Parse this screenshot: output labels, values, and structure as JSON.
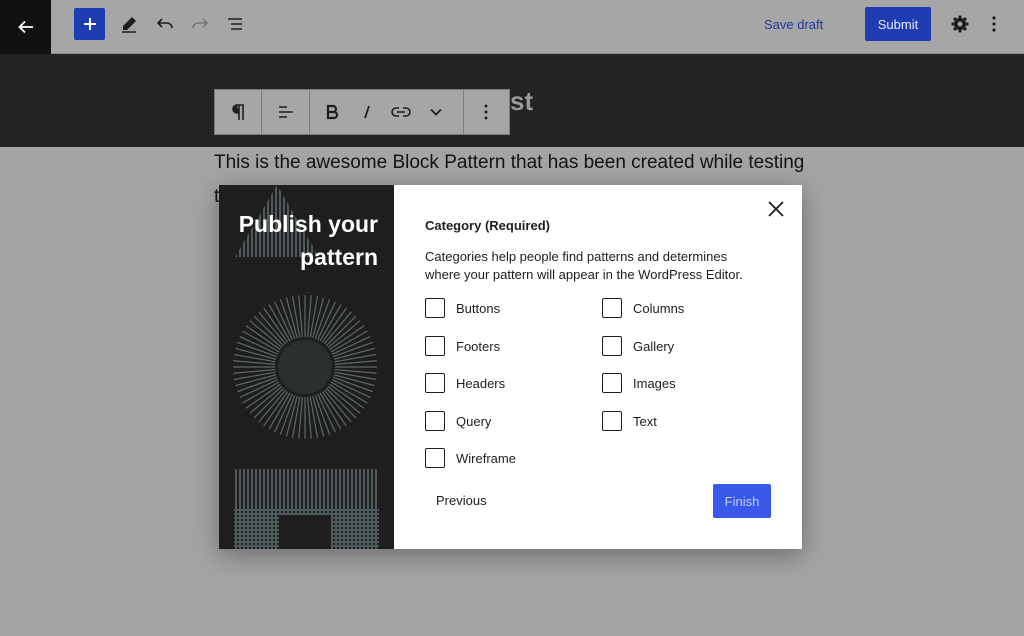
{
  "toolbar": {
    "save_draft": "Save draft",
    "submit": "Submit"
  },
  "editor": {
    "title_fragment": "st",
    "paragraph_line1": "This is the awesome Block Pattern that has been created while testing",
    "paragraph_line2": "t"
  },
  "modal": {
    "side_title": "Publish your pattern",
    "category_heading": "Category (Required)",
    "category_help": "Categories help people find patterns and determines where your pattern will appear in the WordPress Editor.",
    "categories": [
      {
        "label": "Buttons",
        "checked": false
      },
      {
        "label": "Columns",
        "checked": false
      },
      {
        "label": "Footers",
        "checked": false
      },
      {
        "label": "Gallery",
        "checked": false
      },
      {
        "label": "Headers",
        "checked": false
      },
      {
        "label": "Images",
        "checked": false
      },
      {
        "label": "Query",
        "checked": false
      },
      {
        "label": "Text",
        "checked": false
      },
      {
        "label": "Wireframe",
        "checked": false
      }
    ],
    "previous": "Previous",
    "finish": "Finish"
  },
  "colors": {
    "accent": "#3858e9",
    "accent_dark": "#1f3cb3",
    "dark_panel": "#1e1e1e"
  },
  "icons": [
    "arrow-left-icon",
    "plus-icon",
    "pencil-icon",
    "undo-icon",
    "redo-icon",
    "list-view-icon",
    "gear-icon",
    "more-vertical-icon",
    "pilcrow-icon",
    "align-icon",
    "bold-icon",
    "italic-icon",
    "link-icon",
    "chevron-down-icon",
    "close-icon"
  ]
}
